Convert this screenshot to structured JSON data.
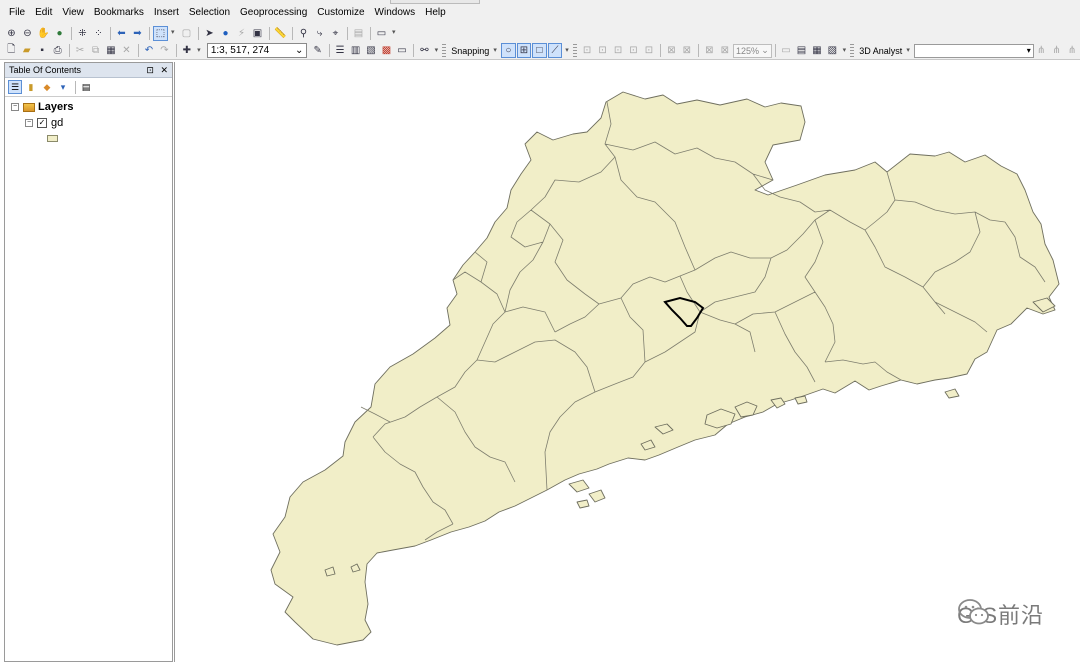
{
  "menu": [
    "File",
    "Edit",
    "View",
    "Bookmarks",
    "Insert",
    "Selection",
    "Geoprocessing",
    "Customize",
    "Windows",
    "Help"
  ],
  "toolbar": {
    "scale": "1:3, 517, 274",
    "snapping_label": "Snapping",
    "zoom_percent": "125%",
    "analyst_label": "3D Analyst",
    "dropdown_arrow": "▾",
    "combo_arrow": "⌄"
  },
  "toc": {
    "title": "Table Of Contents",
    "pin": "⊡",
    "close": "✕",
    "root": {
      "label": "Layers",
      "expanded": true
    },
    "layers": [
      {
        "label": "gd",
        "checked": true,
        "symbol_color": "#f1eec8"
      }
    ]
  },
  "map": {
    "fill_color": "#f1eec8",
    "boundary_color": "#8a8a7a",
    "highlight_color": "#000000"
  },
  "watermark": {
    "text": "GIS前沿",
    "icon": "wechat-icon"
  }
}
